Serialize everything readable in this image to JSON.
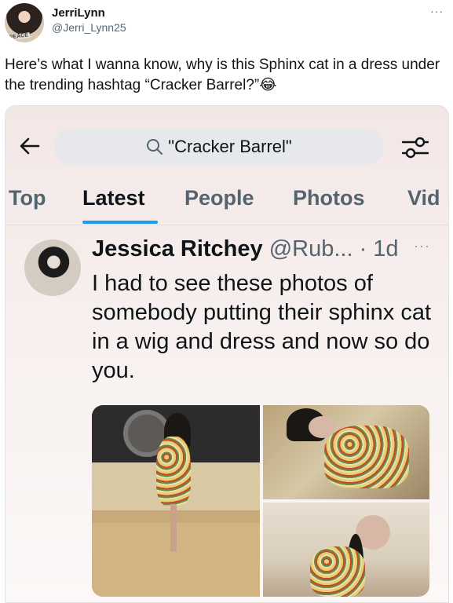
{
  "tweet": {
    "author_name": "JerriLynn",
    "author_handle": "@Jerri_Lynn25",
    "more": "···",
    "avatar_text": "PEACE",
    "text": "Here’s what I wanna know, why is this Sphinx cat in a dress under the trending hashtag “Cracker Barrel?”😂"
  },
  "screenshot": {
    "search": {
      "query": "\"Cracker Barrel\""
    },
    "tabs": [
      {
        "label": "Top",
        "active": false
      },
      {
        "label": "Latest",
        "active": true
      },
      {
        "label": "People",
        "active": false
      },
      {
        "label": "Photos",
        "active": false
      },
      {
        "label": "Vid",
        "active": false
      }
    ],
    "post": {
      "name": "Jessica Ritchey",
      "handle": "@Rub...",
      "time": " · 1d",
      "more": "···",
      "text": "I had to see these photos of somebody putting their sphinx cat in a wig and dress and now so do you."
    },
    "colors": {
      "accent": "#1d9bf0",
      "text": "#0f1419",
      "muted": "#536471"
    }
  }
}
